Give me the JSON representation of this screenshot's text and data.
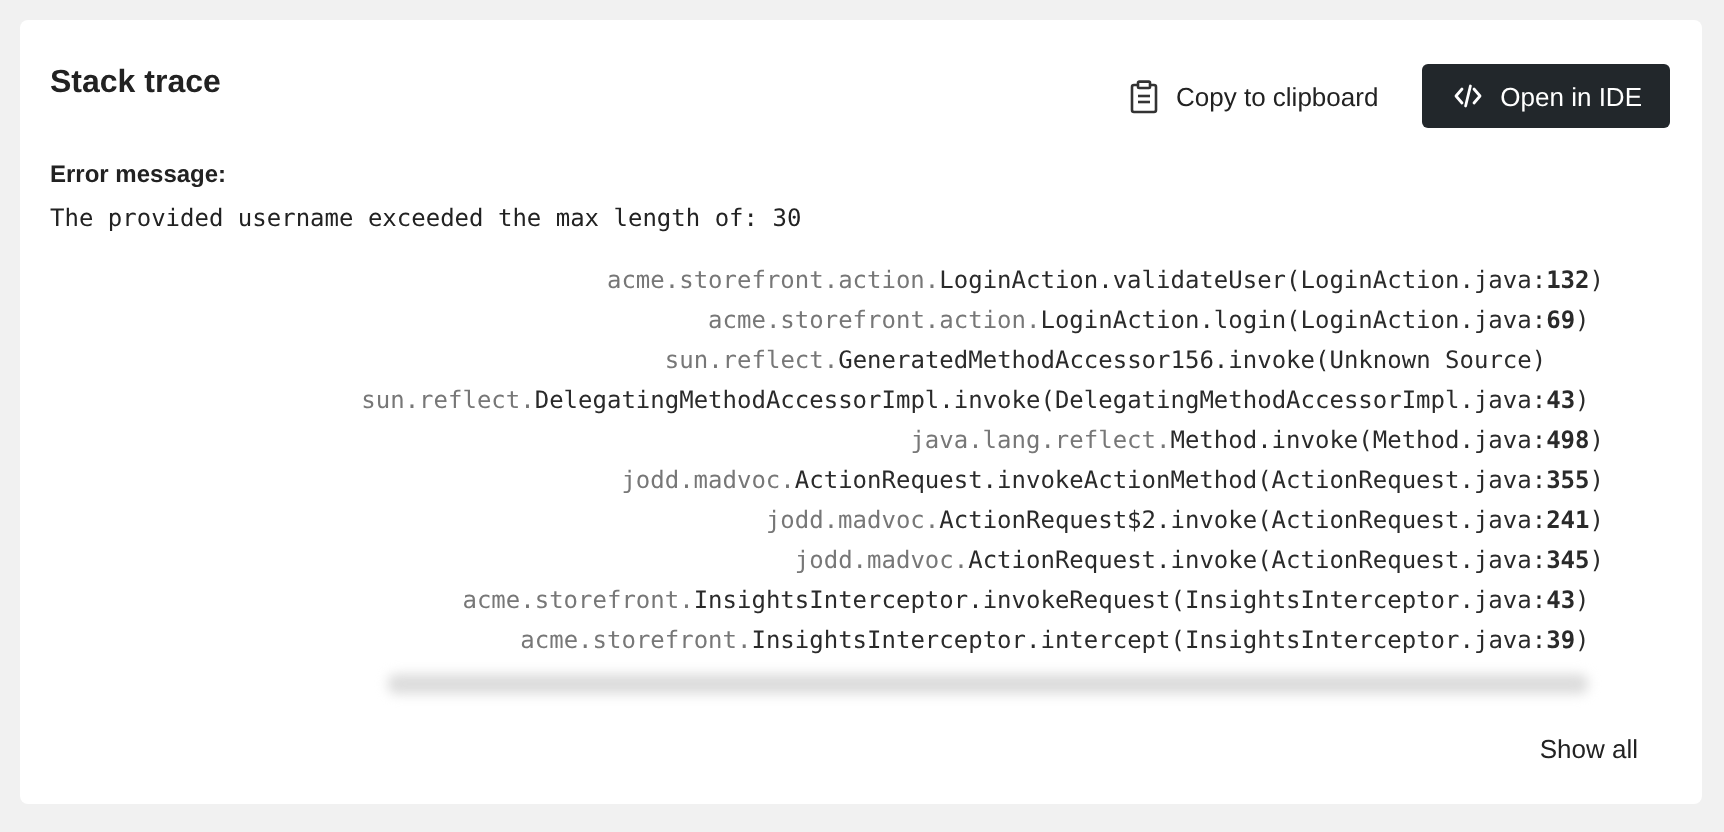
{
  "title": "Stack trace",
  "actions": [
    {
      "kind": "copy",
      "label": "Copy to clipboard"
    },
    {
      "kind": "ide",
      "label": "Open in IDE"
    }
  ],
  "error_label": "Error message:",
  "error_message": "The provided username exceeded the max length of: 30",
  "frames": [
    {
      "package": "acme.storefront.action.",
      "call": "LoginAction.validateUser(LoginAction.java:",
      "line": "132",
      "close": ")"
    },
    {
      "package": "acme.storefront.action.",
      "call": "LoginAction.login(LoginAction.java:",
      "line": "69",
      "close": ")"
    },
    {
      "package": "sun.reflect.",
      "call": "GeneratedMethodAccessor156.invoke(Unknown Source)"
    },
    {
      "package": "sun.reflect.",
      "call": "DelegatingMethodAccessorImpl.invoke(DelegatingMethodAccessorImpl.java:",
      "line": "43",
      "close": ")"
    },
    {
      "package": "java.lang.reflect.",
      "call": "Method.invoke(Method.java:",
      "line": "498",
      "close": ")"
    },
    {
      "package": "jodd.madvoc.",
      "call": "ActionRequest.invokeActionMethod(ActionRequest.java:",
      "line": "355",
      "close": ")"
    },
    {
      "package": "jodd.madvoc.",
      "call": "ActionRequest$2.invoke(ActionRequest.java:",
      "line": "241",
      "close": ")"
    },
    {
      "package": "jodd.madvoc.",
      "call": "ActionRequest.invoke(ActionRequest.java:",
      "line": "345",
      "close": ")"
    },
    {
      "package": "acme.storefront.",
      "call": "InsightsInterceptor.invokeRequest(InsightsInterceptor.java:",
      "line": "43",
      "close": ")"
    },
    {
      "package": "acme.storefront.",
      "call": "InsightsInterceptor.intercept(InsightsInterceptor.java:",
      "line": "39",
      "close": ")"
    }
  ],
  "blurred_line": true,
  "show_all": "Show all"
}
